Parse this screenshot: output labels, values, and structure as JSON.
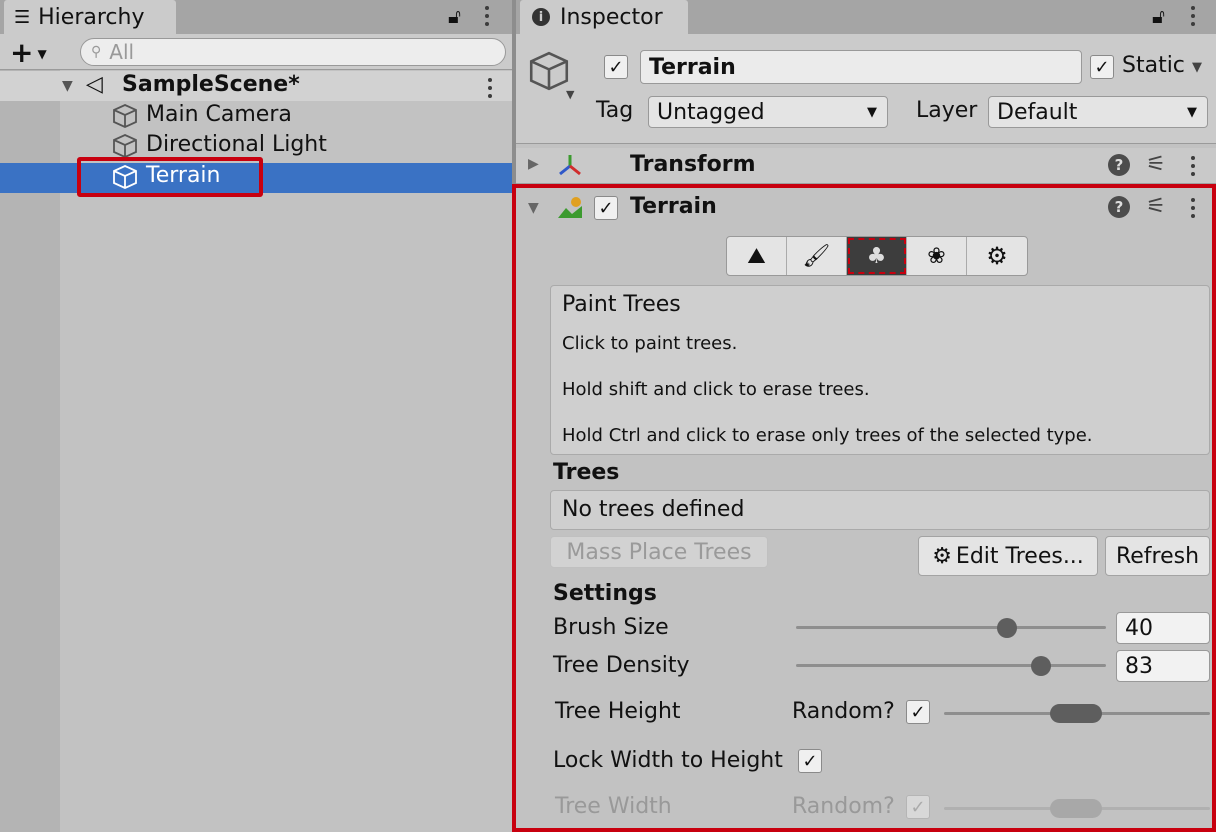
{
  "hierarchy": {
    "tab_label": "Hierarchy",
    "search_placeholder": "All",
    "scene_name": "SampleScene*",
    "items": [
      "Main Camera",
      "Directional Light",
      "Terrain"
    ]
  },
  "inspector": {
    "tab_label": "Inspector",
    "object_name": "Terrain",
    "static_label": "Static",
    "tag_label": "Tag",
    "tag_value": "Untagged",
    "layer_label": "Layer",
    "layer_value": "Default",
    "transform_label": "Transform",
    "terrain_label": "Terrain",
    "paint_trees": {
      "title": "Paint Trees",
      "lines": [
        "Click to paint trees.",
        "Hold shift and click to erase trees.",
        "Hold Ctrl and click to erase only trees of the selected type."
      ]
    },
    "trees_heading": "Trees",
    "no_trees": "No trees defined",
    "mass_place": "Mass Place Trees",
    "edit_trees": "Edit Trees...",
    "refresh": "Refresh",
    "settings_heading": "Settings",
    "brush_size": {
      "label": "Brush Size",
      "value": "40",
      "fraction": 0.68
    },
    "tree_density": {
      "label": "Tree Density",
      "value": "83",
      "fraction": 0.79
    },
    "tree_height": {
      "label": "Tree Height",
      "random_label": "Random?"
    },
    "lock_width": {
      "label": "Lock Width to Height"
    },
    "tree_width": {
      "label": "Tree Width",
      "random_label": "Random?"
    }
  },
  "colors": {
    "selection": "#3a72c4",
    "highlight_red": "#c8000f",
    "panel": "#c2c2c2"
  }
}
